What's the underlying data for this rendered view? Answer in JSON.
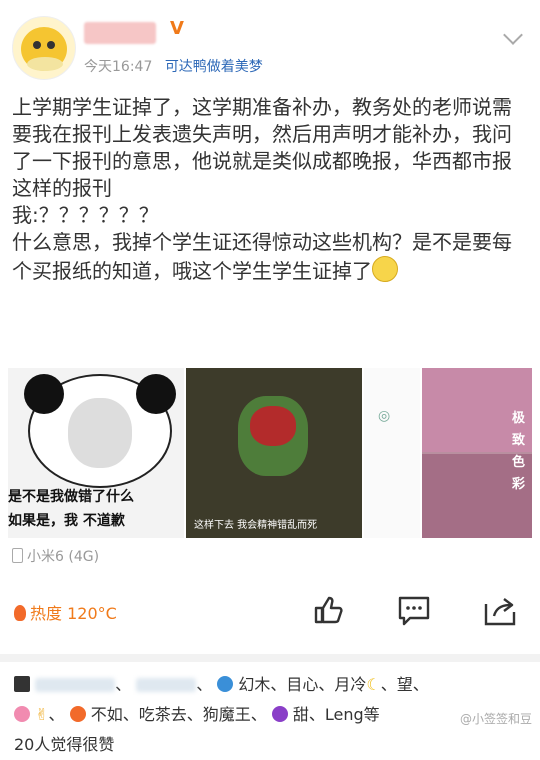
{
  "header": {
    "time": "今天16:47",
    "source": "可达鸭做着美梦"
  },
  "post": {
    "p1": "上学期学生证掉了，这学期准备补办，教务处的老师说需要我在报刊上发表遗失声明，然后用声明才能补办，我问了一下报刊的意思，他说就是类似成都晚报，华西都市报这样的报刊",
    "p2": "我:？？？？？？",
    "p3": "什么意思，我掉个学生证还得惊动这些机构？是不是要每个买报纸的知道，哦这个学生学生证掉了"
  },
  "images": {
    "img1_caption_top": "是不是我做错了什么",
    "img1_caption_bottom": "如果是，我 不道歉",
    "img2_subtitle": "这样下去 我会精神错乱而死",
    "img4_vertical": "极致色彩"
  },
  "device": "小米6 (4G)",
  "toolbar": {
    "heat": "热度 120°C",
    "icons": [
      "like-icon",
      "comment-icon",
      "share-icon"
    ]
  },
  "likes": {
    "line1_names": "幻木、目心、月冷",
    "line1_tail": "、望、",
    "line2": "不如、吃茶去、狗魔王、",
    "line2_tail": "甜、Leng等",
    "line3": "20人觉得很赞"
  },
  "watermark": "@小签签和豆"
}
